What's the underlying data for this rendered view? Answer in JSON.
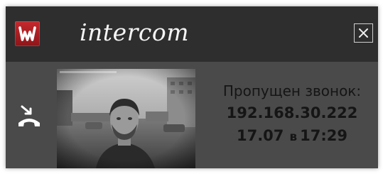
{
  "window": {
    "logo_icon": "app-logo-w",
    "title": "intercom",
    "close_icon": "close-icon"
  },
  "call": {
    "hangup_icon": "phone-hangup-icon",
    "camera_feed": "camera-snapshot",
    "status": "Пропущен звонок:",
    "ip": "192.168.30.222",
    "date": "17.07",
    "at": "в",
    "time": "17:29"
  },
  "colors": {
    "titlebar": "#2e2e2e",
    "panel": "#4a4a4a",
    "logo": "#b8242a",
    "title_text": "#f4f4f4",
    "info_text": "#151515"
  }
}
